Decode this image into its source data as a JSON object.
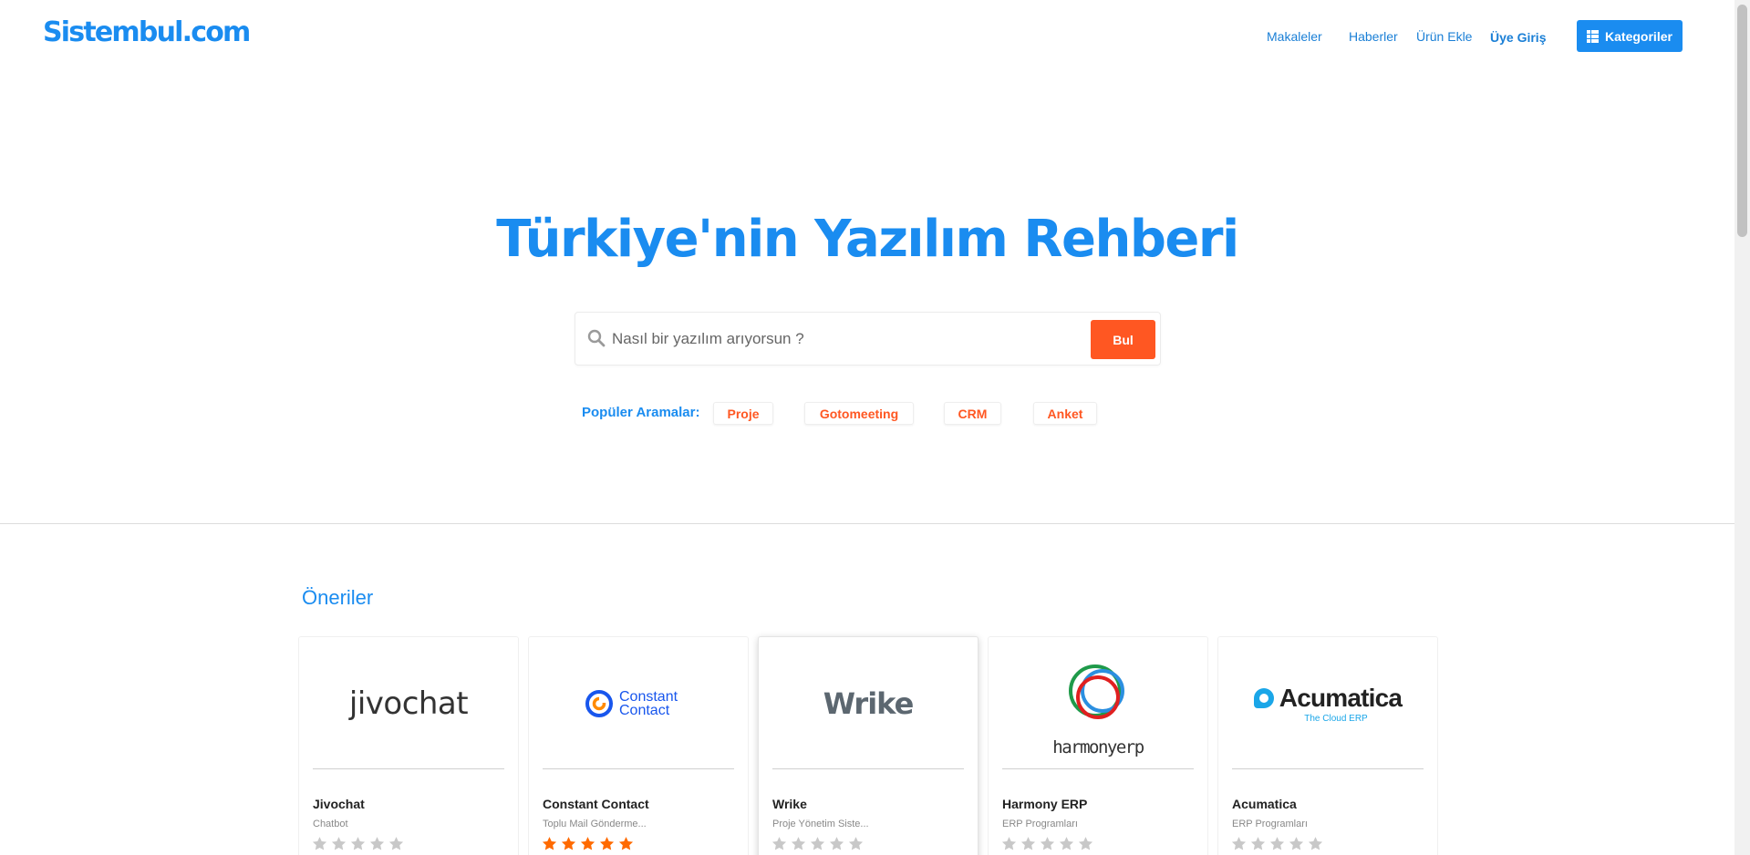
{
  "header": {
    "logo": "Sistembul.com",
    "nav": [
      "Makaleler",
      "Haberler",
      "Ürün Ekle",
      "Üye Giriş"
    ],
    "categories_button": "Kategoriler"
  },
  "hero": {
    "title": "Türkiye'nin Yazılım Rehberi",
    "search_placeholder": "Nasıl bir yazılım arıyorsun ?",
    "search_button": "Bul",
    "popular_label": "Popüler Aramalar:",
    "popular_tags": [
      "Proje",
      "Gotomeeting",
      "CRM",
      "Anket"
    ]
  },
  "recommendations": {
    "title": "Öneriler",
    "cards": [
      {
        "logo_text": "jivochat",
        "name": "Jivochat",
        "category": "Chatbot",
        "rating": 0
      },
      {
        "logo_text": "Constant Contact",
        "name": "Constant Contact",
        "category": "Toplu Mail Gönderme...",
        "rating": 5
      },
      {
        "logo_text": "Wrike",
        "name": "Wrike",
        "category": "Proje Yönetim Siste...",
        "rating": 0
      },
      {
        "logo_text": "harmonyerp",
        "name": "Harmony ERP",
        "category": "ERP Programları",
        "rating": 0
      },
      {
        "logo_text": "Acumatica",
        "logo_subtext": "The Cloud ERP",
        "name": "Acumatica",
        "category": "ERP Programları",
        "rating": 0
      }
    ]
  },
  "colors": {
    "brand_blue": "#1a8cf0",
    "accent_orange": "#ff5722",
    "star_filled": "#ff6a00",
    "star_empty": "#c8c8c8"
  }
}
